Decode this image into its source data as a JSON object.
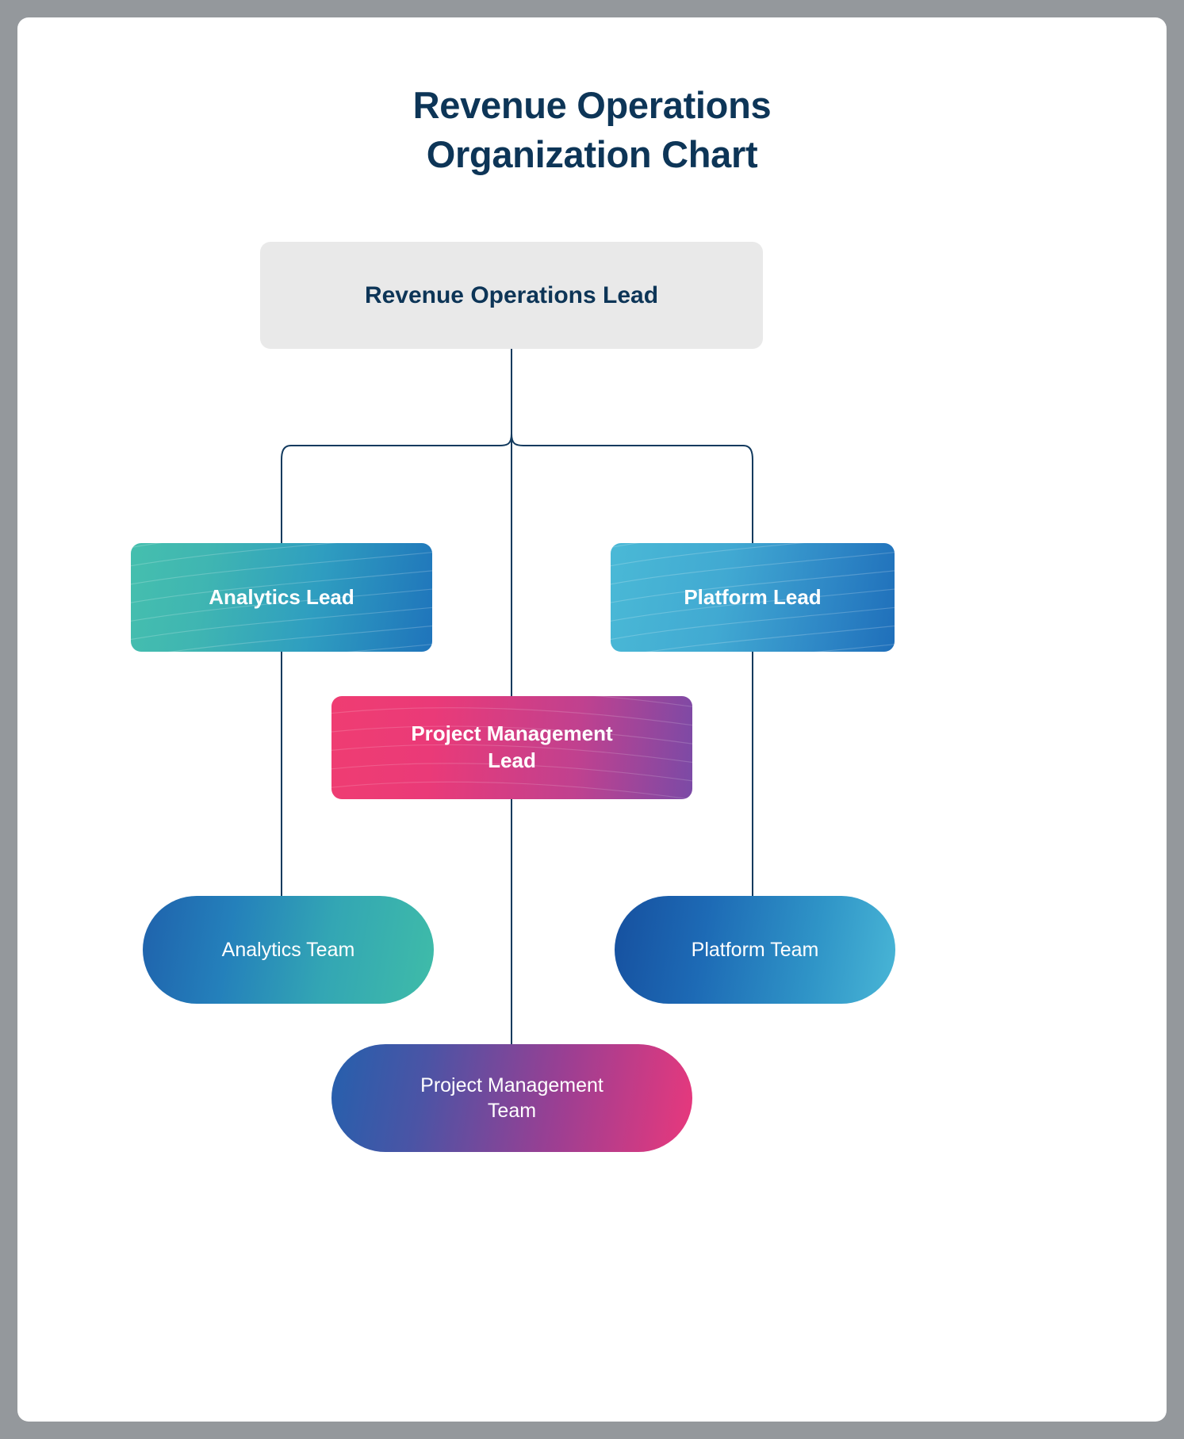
{
  "page": {
    "background_color": "#94989c",
    "card_color": "#ffffff"
  },
  "title": {
    "line1": "Revenue Operations",
    "line2": "Organization Chart",
    "full": "Revenue Operations Organization Chart",
    "color": "#0d3557"
  },
  "nodes": {
    "root": {
      "label": "Revenue Operations Lead",
      "level": 0,
      "shape": "rounded-rect",
      "fill": "#e9e9e9",
      "text_color": "#0d3557"
    },
    "analytics_lead": {
      "label": "Analytics Lead",
      "level": 1,
      "shape": "rounded-rect",
      "gradient_from": "#45bfae",
      "gradient_to": "#1f74bb",
      "text_color": "#ffffff"
    },
    "platform_lead": {
      "label": "Platform Lead",
      "level": 1,
      "shape": "rounded-rect",
      "gradient_from": "#4ab9d6",
      "gradient_to": "#1f6fba",
      "text_color": "#ffffff"
    },
    "pm_lead": {
      "label": "Project Management Lead",
      "line1": "Project Management",
      "line2": "Lead",
      "level": 1,
      "shape": "rounded-rect",
      "gradient_from": "#ef3d72",
      "gradient_to": "#7b4aa6",
      "text_color": "#ffffff"
    },
    "analytics_team": {
      "label": "Analytics Team",
      "level": 2,
      "shape": "pill",
      "gradient_from": "#1f62ac",
      "gradient_to": "#3fbca8",
      "text_color": "#ffffff"
    },
    "platform_team": {
      "label": "Platform Team",
      "level": 2,
      "shape": "pill",
      "gradient_from": "#16509f",
      "gradient_to": "#49b6d6",
      "text_color": "#ffffff"
    },
    "pm_team": {
      "label": "Project Management Team",
      "line1": "Project Management",
      "line2": "Team",
      "level": 2,
      "shape": "pill",
      "gradient_from": "#2560ad",
      "gradient_to": "#e9387c",
      "text_color": "#ffffff"
    }
  },
  "connectors": {
    "color": "#123a5e",
    "width": 2,
    "edges": [
      {
        "from": "root",
        "to": "analytics_lead"
      },
      {
        "from": "root",
        "to": "pm_lead"
      },
      {
        "from": "root",
        "to": "platform_lead"
      },
      {
        "from": "analytics_lead",
        "to": "analytics_team"
      },
      {
        "from": "platform_lead",
        "to": "platform_team"
      },
      {
        "from": "pm_lead",
        "to": "pm_team"
      }
    ]
  },
  "chart_data": {
    "type": "diagram",
    "subtype": "organization-chart",
    "title": "Revenue Operations Organization Chart",
    "orientation": "top-down",
    "levels": 3,
    "nodes": [
      {
        "id": "root",
        "label": "Revenue Operations Lead",
        "level": 0,
        "parent": null
      },
      {
        "id": "analytics_lead",
        "label": "Analytics Lead",
        "level": 1,
        "parent": "root"
      },
      {
        "id": "pm_lead",
        "label": "Project Management Lead",
        "level": 1,
        "parent": "root"
      },
      {
        "id": "platform_lead",
        "label": "Platform Lead",
        "level": 1,
        "parent": "root"
      },
      {
        "id": "analytics_team",
        "label": "Analytics Team",
        "level": 2,
        "parent": "analytics_lead"
      },
      {
        "id": "pm_team",
        "label": "Project Management Team",
        "level": 2,
        "parent": "pm_lead"
      },
      {
        "id": "platform_team",
        "label": "Platform Team",
        "level": 2,
        "parent": "platform_lead"
      }
    ],
    "edges": [
      [
        "root",
        "analytics_lead"
      ],
      [
        "root",
        "pm_lead"
      ],
      [
        "root",
        "platform_lead"
      ],
      [
        "analytics_lead",
        "analytics_team"
      ],
      [
        "pm_lead",
        "pm_team"
      ],
      [
        "platform_lead",
        "platform_team"
      ]
    ]
  }
}
